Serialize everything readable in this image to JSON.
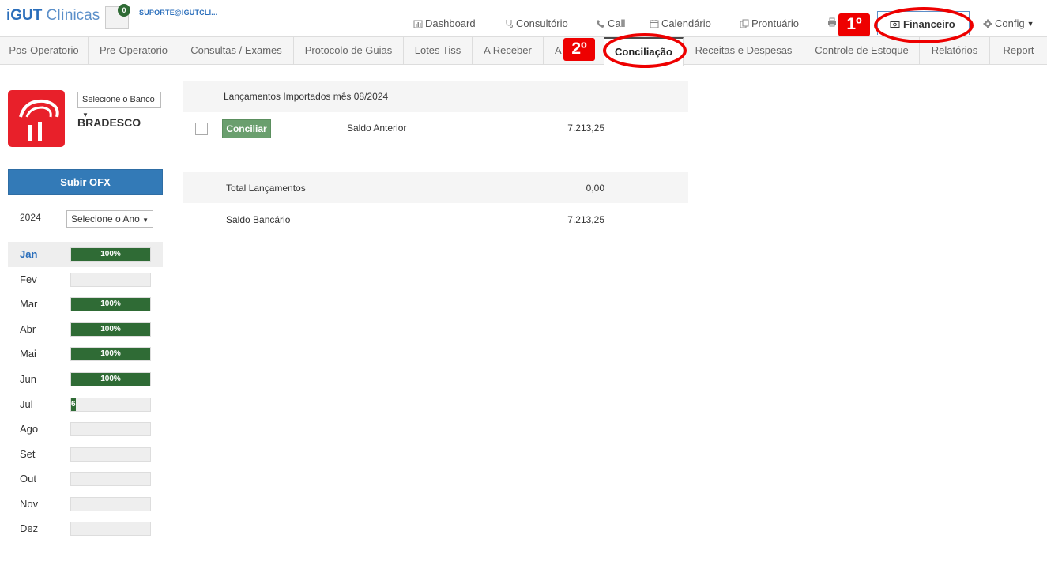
{
  "header": {
    "logo_bold": "iGUT",
    "logo_light": "Clínicas",
    "notification_count": "0",
    "user": "SUPORTE@IGUTCLI...",
    "nav": [
      {
        "label": "Dashboard",
        "icon": "bar-chart-icon"
      },
      {
        "label": "Consultório",
        "icon": "stethoscope-icon"
      },
      {
        "label": "Call",
        "icon": "phone-icon"
      },
      {
        "label": "Calendário",
        "icon": "calendar-icon"
      },
      {
        "label": "Prontuário",
        "icon": "copy-icon"
      },
      {
        "label": "Financeiro",
        "icon": "money-icon"
      },
      {
        "label": "Config",
        "icon": "gear-icon"
      }
    ]
  },
  "annotations": {
    "first": "1º",
    "second": "2º",
    "color": "#e00000"
  },
  "tabs": [
    "Pos-Operatorio",
    "Pre-Operatorio",
    "Consultas / Exames",
    "Protocolo de Guias",
    "Lotes Tiss",
    "A Receber",
    "A",
    "Conciliação",
    "Receitas e Despesas",
    "Controle de Estoque",
    "Relatórios",
    "Report"
  ],
  "sidebar": {
    "bank_select": "Selecione o Banco",
    "bank_name": "BRADESCO",
    "upload_button": "Subir OFX",
    "year": "2024",
    "year_select": "Selecione o Ano",
    "months": [
      {
        "name": "Jan",
        "progress": 100,
        "label": "100%"
      },
      {
        "name": "Fev",
        "progress": 0,
        "label": ""
      },
      {
        "name": "Mar",
        "progress": 100,
        "label": "100%"
      },
      {
        "name": "Abr",
        "progress": 100,
        "label": "100%"
      },
      {
        "name": "Mai",
        "progress": 100,
        "label": "100%"
      },
      {
        "name": "Jun",
        "progress": 100,
        "label": "100%"
      },
      {
        "name": "Jul",
        "progress": 6,
        "label": "6"
      },
      {
        "name": "Ago",
        "progress": 0,
        "label": ""
      },
      {
        "name": "Set",
        "progress": 0,
        "label": ""
      },
      {
        "name": "Out",
        "progress": 0,
        "label": ""
      },
      {
        "name": "Nov",
        "progress": 0,
        "label": ""
      },
      {
        "name": "Dez",
        "progress": 0,
        "label": ""
      }
    ]
  },
  "main": {
    "title": "Lançamentos Importados mês 08/2024",
    "reconcile_button": "Conciliar",
    "previous_balance_label": "Saldo Anterior",
    "previous_balance_value": "7.213,25",
    "total_label": "Total Lançamentos",
    "total_value": "0,00",
    "bank_balance_label": "Saldo Bancário",
    "bank_balance_value": "7.213,25"
  },
  "colors": {
    "brand": "#2a6ebb",
    "progress": "#2f6b35",
    "bank_red": "#e8202a",
    "primary_button": "#337ab7"
  }
}
